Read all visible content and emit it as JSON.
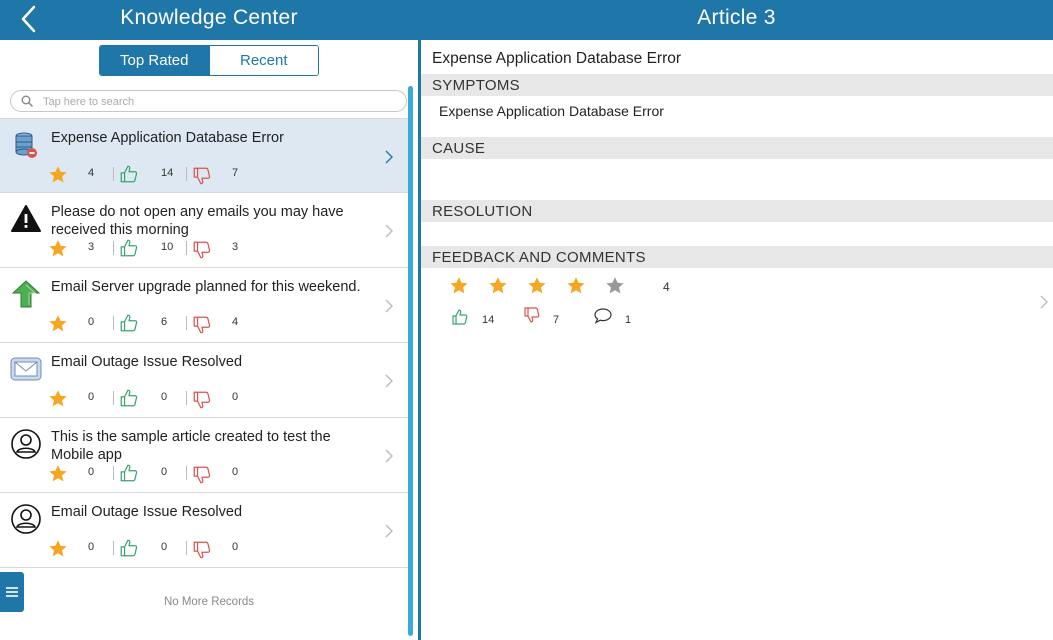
{
  "header": {
    "left_title": "Knowledge Center",
    "right_title": "Article 3",
    "back_icon": "chevron-left-icon",
    "bar_color": "#1f76a8"
  },
  "tabs": [
    {
      "label": "Top Rated",
      "selected": true
    },
    {
      "label": "Recent",
      "selected": false
    }
  ],
  "search": {
    "placeholder": "Tap here to search"
  },
  "articles": [
    {
      "title": "Expense Application Database Error",
      "icon": "database-icon",
      "rating": "4",
      "likes": "14",
      "dislikes": "7",
      "selected": true
    },
    {
      "title": "Please do not open any emails you may have received this morning",
      "icon": "warning-icon",
      "rating": "3",
      "likes": "10",
      "dislikes": "3",
      "selected": false
    },
    {
      "title": "Email Server upgrade planned for this weekend.",
      "icon": "upgrade-arrow-icon",
      "rating": "0",
      "likes": "6",
      "dislikes": "4",
      "selected": false
    },
    {
      "title": "Email Outage Issue Resolved",
      "icon": "envelope-icon",
      "rating": "0",
      "likes": "0",
      "dislikes": "0",
      "selected": false
    },
    {
      "title": "This is the sample article created to test the Mobile app",
      "icon": "user-circle-icon",
      "rating": "0",
      "likes": "0",
      "dislikes": "0",
      "selected": false
    },
    {
      "title": "Email Outage Issue Resolved",
      "icon": "user-circle-icon",
      "rating": "0",
      "likes": "0",
      "dislikes": "0",
      "selected": false
    }
  ],
  "list_footer": "No More Records",
  "detail": {
    "title": "Expense Application Database Error",
    "symptoms_header": "SYMPTOMS",
    "symptoms_text": "Expense Application Database Error",
    "cause_header": "CAUSE",
    "cause_text": "",
    "resolution_header": "RESOLUTION",
    "resolution_text": "",
    "feedback_header": "FEEDBACK AND COMMENTS",
    "stars_filled": 4,
    "stars_total": 5,
    "rating": "4",
    "likes": "14",
    "dislikes": "7",
    "comments": "1"
  },
  "colors": {
    "star": "#f5a623",
    "star_empty": "#999999",
    "like": "#3aa36a",
    "dislike": "#d9534f",
    "selected_row": "#dde8f3"
  }
}
